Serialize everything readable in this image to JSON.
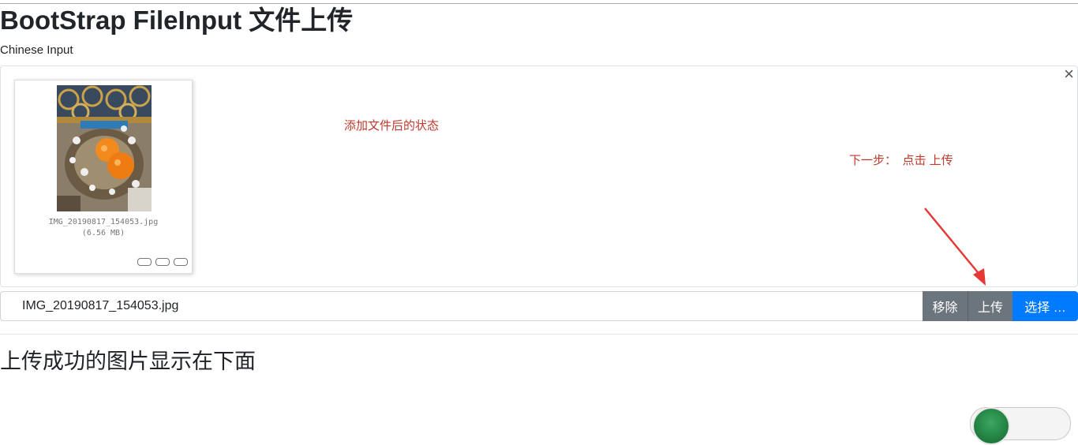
{
  "page": {
    "title": "BootStrap FileInput 文件上传",
    "subtitle": "Chinese Input",
    "section_title": "上传成功的图片显示在下面"
  },
  "preview": {
    "close_icon": "close-icon",
    "thumbnail": {
      "image_icon": "photo-thumbnail",
      "file_name": "IMG_20190817_154053.jpg",
      "file_size": "(6.56 MB)"
    }
  },
  "annotations": {
    "state_note": "添加文件后的状态",
    "next_step": "下一步：　点击 上传",
    "arrow_color": "#e53935"
  },
  "file_input": {
    "caption": "IMG_20190817_154053.jpg",
    "remove_label": "移除",
    "upload_label": "上传",
    "browse_label": "选择 …"
  },
  "colors": {
    "secondary_button": "#6c757d",
    "primary_button": "#007bff",
    "annotation_text": "#c0392b"
  }
}
